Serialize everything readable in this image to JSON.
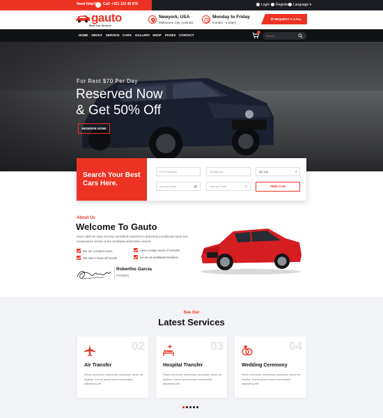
{
  "topbar": {
    "help_label": "Need Help?",
    "call_label": "Call: +321 123 45 978",
    "login_label": "Login",
    "register_label": "Register",
    "language_label": "Language"
  },
  "header": {
    "logo_text": "gauto",
    "logo_tagline": "Best Car Service",
    "location_title": "Newyork, USA",
    "location_sub": "Melbourne City, Australia",
    "hours_title": "Monday to Friday",
    "hours_sub": "9.00am - 6.00pm",
    "request_call_label": "REQUEST A CALL"
  },
  "nav": {
    "items": [
      "HOME",
      "ABOUT",
      "SERVICE",
      "CARS",
      "GALLERY",
      "SHOP",
      "PAGES",
      "CONTACT"
    ],
    "cart_count": "0",
    "search_placeholder": "Search"
  },
  "hero": {
    "kicker": "For Rent $70 Per Day",
    "title_line1": "Reserved Now",
    "title_line2": "& Get 50% Off",
    "button_label": "RESERVE NOW!"
  },
  "search_panel": {
    "title_line1": "Search Your Best",
    "title_line2": "Cars Here.",
    "from_placeholder": "From Address",
    "to_placeholder": "To Address",
    "car_type_value": "AC Car",
    "date_placeholder": "Journey Date",
    "time_placeholder": "Journey Time",
    "find_label": "FIND CAR"
  },
  "about": {
    "kicker": "About Us",
    "title": "Welcome To Gauto",
    "text": "Since 1992 we have not only committed ourselves to delivering exceptional repair and maintenance service to the worldwide automotive owners.",
    "checks": [
      "We are a trusted name",
      "Have a larger stock of vehicles",
      "We deal in have all brands",
      "we are at worldwide locations"
    ],
    "signer_name": "Robertho Garcia",
    "signer_role": "President"
  },
  "services": {
    "kicker": "See Our",
    "title": "Latest Services",
    "cards": [
      {
        "num": "02",
        "title": "Air Transfer",
        "text": "Risus commodo maecenas accumsan lacus vel facilisis. Dorem ipsum dolor consectetur adipiscing elit.",
        "icon": "airplane-icon"
      },
      {
        "num": "03",
        "title": "Hospital Transfer",
        "text": "Risus commodo maecenas accumsan lacus vel facilisis. Dorem ipsum dolor consectetur adipiscing elit.",
        "icon": "hospital-bed-icon"
      },
      {
        "num": "04",
        "title": "Wedding Ceremony",
        "text": "Risus commodo maecenas accumsan lacus vel facilisis. Dorem ipsum dolor consectetur adipiscing elit.",
        "icon": "rings-icon"
      }
    ]
  },
  "colors": {
    "accent": "#ec3323",
    "dark": "#111214"
  }
}
